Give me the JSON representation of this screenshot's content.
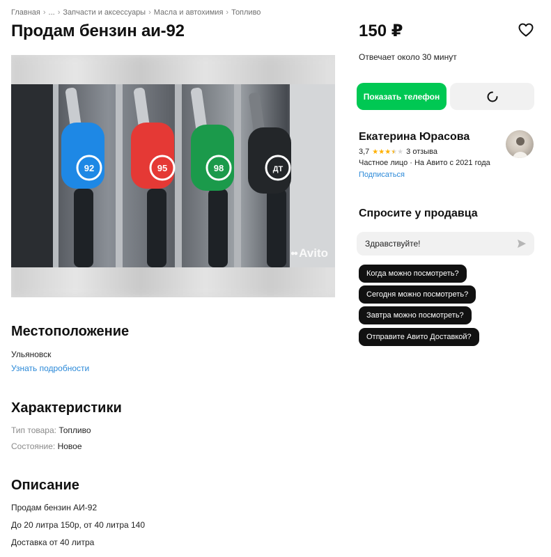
{
  "breadcrumb": {
    "items": [
      "Главная",
      "...",
      "Запчасти и аксессуары",
      "Масла и автохимия",
      "Топливо"
    ],
    "separator": "›"
  },
  "listing": {
    "title": "Продам бензин аи-92",
    "image_watermark": "Avito",
    "nozzle_labels": [
      "92",
      "95",
      "98",
      "ДТ"
    ]
  },
  "location": {
    "heading": "Местоположение",
    "city": "Ульяновск",
    "details_link": "Узнать подробности"
  },
  "characteristics": {
    "heading": "Характеристики",
    "rows": [
      {
        "label": "Тип товара:",
        "value": "Топливо"
      },
      {
        "label": "Состояние:",
        "value": "Новое"
      }
    ]
  },
  "description": {
    "heading": "Описание",
    "lines": [
      "Продам бензин АИ-92",
      "До 20 литра 150р, от 40 литра 140",
      "Доставка от 40 литра"
    ]
  },
  "sidebar": {
    "price": "150 ₽",
    "reply_time": "Отвечает около 30 минут",
    "show_phone_button": "Показать телефон",
    "accent_color": "#00c853",
    "link_color": "#2b89d8",
    "seller": {
      "name": "Екатерина Юрасова",
      "rating": "3,7",
      "stars_filled": 3.5,
      "stars_total": 5,
      "reviews": "3 отзыва",
      "info": "Частное лицо · На Авито с 2021 года",
      "subscribe": "Подписаться"
    },
    "ask": {
      "heading": "Спросите у продавца",
      "input_value": "Здравствуйте!",
      "quick_questions": [
        "Когда можно посмотреть?",
        "Сегодня можно посмотреть?",
        "Завтра можно посмотреть?",
        "Отправите Авито Доставкой?"
      ]
    }
  },
  "icons": {
    "favorite": "heart-icon",
    "loading": "spinner-icon",
    "send": "send-icon"
  }
}
